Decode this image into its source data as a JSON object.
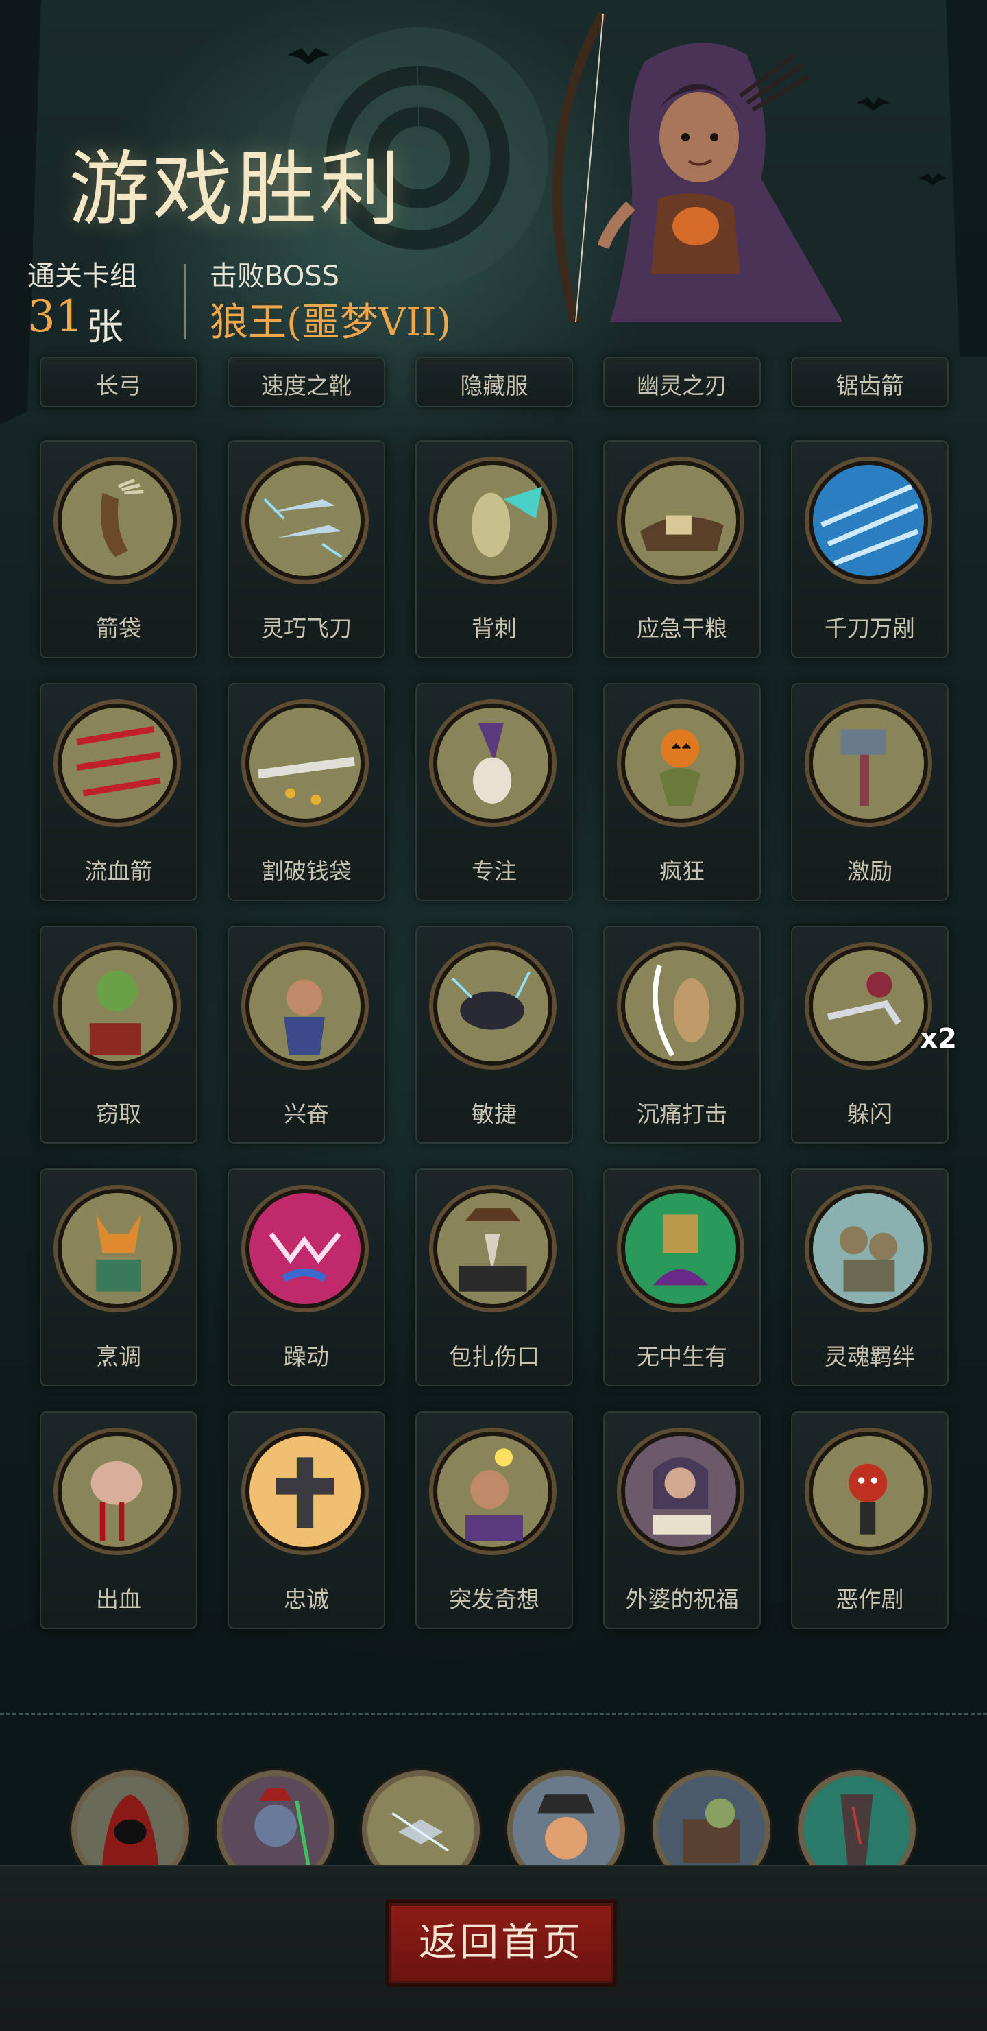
{
  "header": {
    "title": "游戏胜利",
    "deck_label": "通关卡组",
    "deck_count": "31",
    "deck_unit": "张",
    "boss_label": "击败BOSS",
    "boss_name": "狼王(噩梦VII)"
  },
  "partial_row": [
    "长弓",
    "速度之靴",
    "隐藏服",
    "幽灵之刃",
    "锯齿箭"
  ],
  "cards": [
    [
      "箭袋",
      "灵巧飞刀",
      "背刺",
      "应急干粮",
      "千刀万剐"
    ],
    [
      "流血箭",
      "割破钱袋",
      "专注",
      "疯狂",
      "激励"
    ],
    [
      "窃取",
      "兴奋",
      "敏捷",
      "沉痛打击",
      "躲闪"
    ],
    [
      "烹调",
      "躁动",
      "包扎伤口",
      "无中生有",
      "灵魂羁绊"
    ],
    [
      "出血",
      "忠诚",
      "突发奇想",
      "外婆的祝福",
      "恶作剧"
    ]
  ],
  "dodge_badge": "x2",
  "relic_count": 6,
  "return_button": "返回首页",
  "colors": {
    "accent_orange": "#f0a64a",
    "button_red": "#8e1c17",
    "title_cream": "#f3e7c6"
  }
}
